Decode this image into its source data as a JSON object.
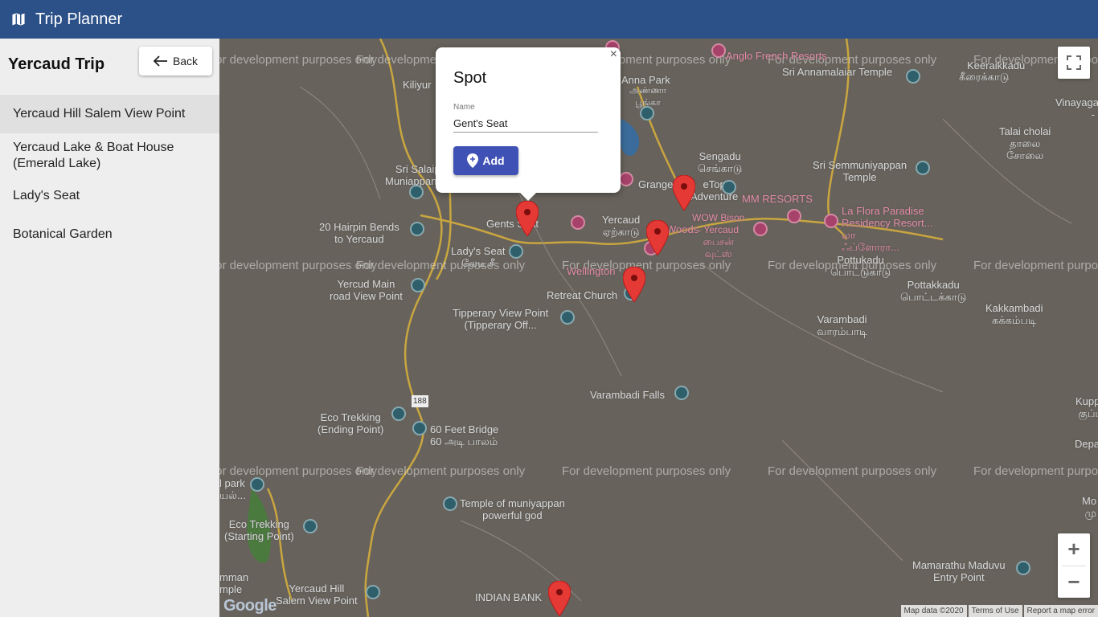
{
  "app": {
    "title": "Trip Planner",
    "icon": "map-icon"
  },
  "sidebar": {
    "trip_title": "Yercaud Trip",
    "back_label": "Back",
    "spots": [
      "Yercaud Hill Salem View Point",
      "Yercaud Lake & Boat House (Emerald Lake)",
      "Lady's Seat",
      "Botanical Garden"
    ]
  },
  "map": {
    "watermark": "For development purposes only",
    "labels": {
      "anna_park": "Anna Park",
      "anna_park_ta": "அண்ணா\nபூங்கா",
      "kiliyur": "Kiliyur",
      "anglo_french": "Anglo French Resorts",
      "annamalaiar": "Sri Annamalaiar Temple",
      "keeraikkadu_ta": "கீரைக்காடு",
      "vinayaga": "Vinayaga te\n- Pe",
      "talai_cholai": "Talai cholai\nதாலை\nசோலை",
      "sengadu": "Sengadu\nசெங்காடு",
      "semmuniyappan": "Sri Semmuniyappan\nTemple",
      "keeraikkadu": "Keeraikkadu",
      "sri_salai": "Sri Salaip\nMuniappan Te",
      "grange": "Grange",
      "rooftop": "eTop\nAdventure",
      "mm_resorts": "MM RESORTS",
      "la_flora": "La Flora Paradise\nResidency Resort...\nலா\nஃப்ளோரா...",
      "hairpin": "20 Hairpin Bends\nto Yercaud",
      "gents_seat": "Gents Seat",
      "yercaud": "Yercaud\nஏற்காடு",
      "woods": "Woods",
      "wow_bison": "WOW Bison\n- Yercaud\nபைசன்\nவுட்ஸ்",
      "ladys_seat": "Lady's Seat\nலேடீ சீ",
      "pottukadu": "Pottukadu\nபொட்டுகாடு",
      "pottakkadu": "Pottakkadu\nபொட்டக்காடு",
      "yercud_main": "Yercud Main\nroad View Point",
      "wellington": "Wellington",
      "retreat": "Retreat Church",
      "tipperary": "Tipperary View Point\n(Tipperary Off...",
      "varambadi": "Varambadi\nவாரம்பாடி",
      "kakkambadi": "Kakkambadi\nகக்கம்படி",
      "varambadi_falls": "Varambadi Falls",
      "kuppa": "Kuppa\nகுப்ப",
      "depart": "Depart",
      "route_188": "188",
      "eco_ending": "Eco Trekking\n(Ending Point)",
      "feet_bridge": "60 Feet Bridge\n60 அடி பாலம்",
      "park": "l park\nயல்...",
      "temple_muni": "Temple of muniyappan\npowerful god",
      "mo": "Mo\n மு",
      "eco_starting": "Eco Trekking\n(Starting Point)",
      "amman": "mman\nmple",
      "yercaud_hill": "Yercaud Hill\nSalem View Point",
      "indian_bank": "INDIAN BANK",
      "mamarathu": "Mamarathu Maduvu\nEntry Point"
    },
    "attribution": [
      "Map data ©2020",
      "Terms of Use",
      "Report a map error"
    ],
    "logo": "Google",
    "zoom_in": "+",
    "zoom_out": "−"
  },
  "popup": {
    "title": "Spot",
    "field_label": "Name",
    "field_value": "Gent's Seat",
    "add_label": "Add",
    "close": "×"
  },
  "colors": {
    "appbar": "#2c5189",
    "add_button": "#3f51b5",
    "marker": "#e53935"
  }
}
